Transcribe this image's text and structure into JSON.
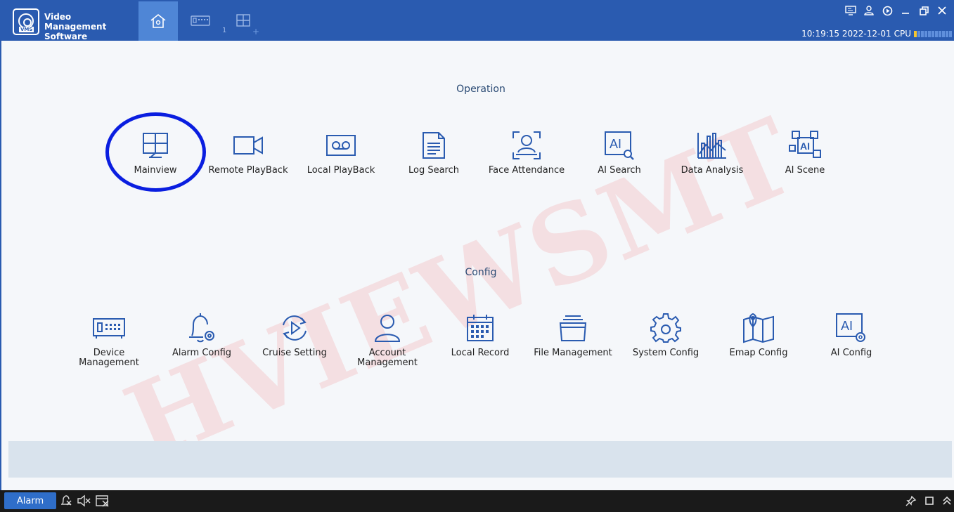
{
  "app": {
    "title_line1": "Video Management",
    "title_line2": "Software",
    "logo_text": "VMS"
  },
  "tabs": {
    "view_number": "1",
    "add_label": "+"
  },
  "status": {
    "datetime": "10:19:15 2022-12-01",
    "cpu_label": "CPU",
    "cpu_level": 0.09
  },
  "operation": {
    "title": "Operation",
    "items": [
      {
        "label": "Mainview",
        "icon": "mainview-icon"
      },
      {
        "label": "Remote PlayBack",
        "icon": "camera-icon"
      },
      {
        "label": "Local PlayBack",
        "icon": "tape-icon"
      },
      {
        "label": "Log Search",
        "icon": "document-icon"
      },
      {
        "label": "Face Attendance",
        "icon": "face-scan-icon"
      },
      {
        "label": "AI Search",
        "icon": "ai-search-icon"
      },
      {
        "label": "Data Analysis",
        "icon": "chart-icon"
      },
      {
        "label": "AI Scene",
        "icon": "ai-scene-icon"
      }
    ]
  },
  "config": {
    "title": "Config",
    "items": [
      {
        "label": "Device Management",
        "icon": "device-icon"
      },
      {
        "label": "Alarm Config",
        "icon": "bell-gear-icon"
      },
      {
        "label": "Cruise Setting",
        "icon": "cruise-icon"
      },
      {
        "label": "Account Management",
        "icon": "user-icon"
      },
      {
        "label": "Local Record",
        "icon": "calendar-icon"
      },
      {
        "label": "File Management",
        "icon": "folder-icon"
      },
      {
        "label": "System Config",
        "icon": "gear-icon"
      },
      {
        "label": "Emap Config",
        "icon": "map-icon"
      },
      {
        "label": "AI Config",
        "icon": "ai-config-icon"
      }
    ]
  },
  "watermark": "HVIEWSMT",
  "bottom": {
    "alarm_label": "Alarm"
  },
  "colors": {
    "titlebar": "#2a5bb0",
    "accent": "#2f6ec9",
    "icon": "#2a5bb0"
  }
}
